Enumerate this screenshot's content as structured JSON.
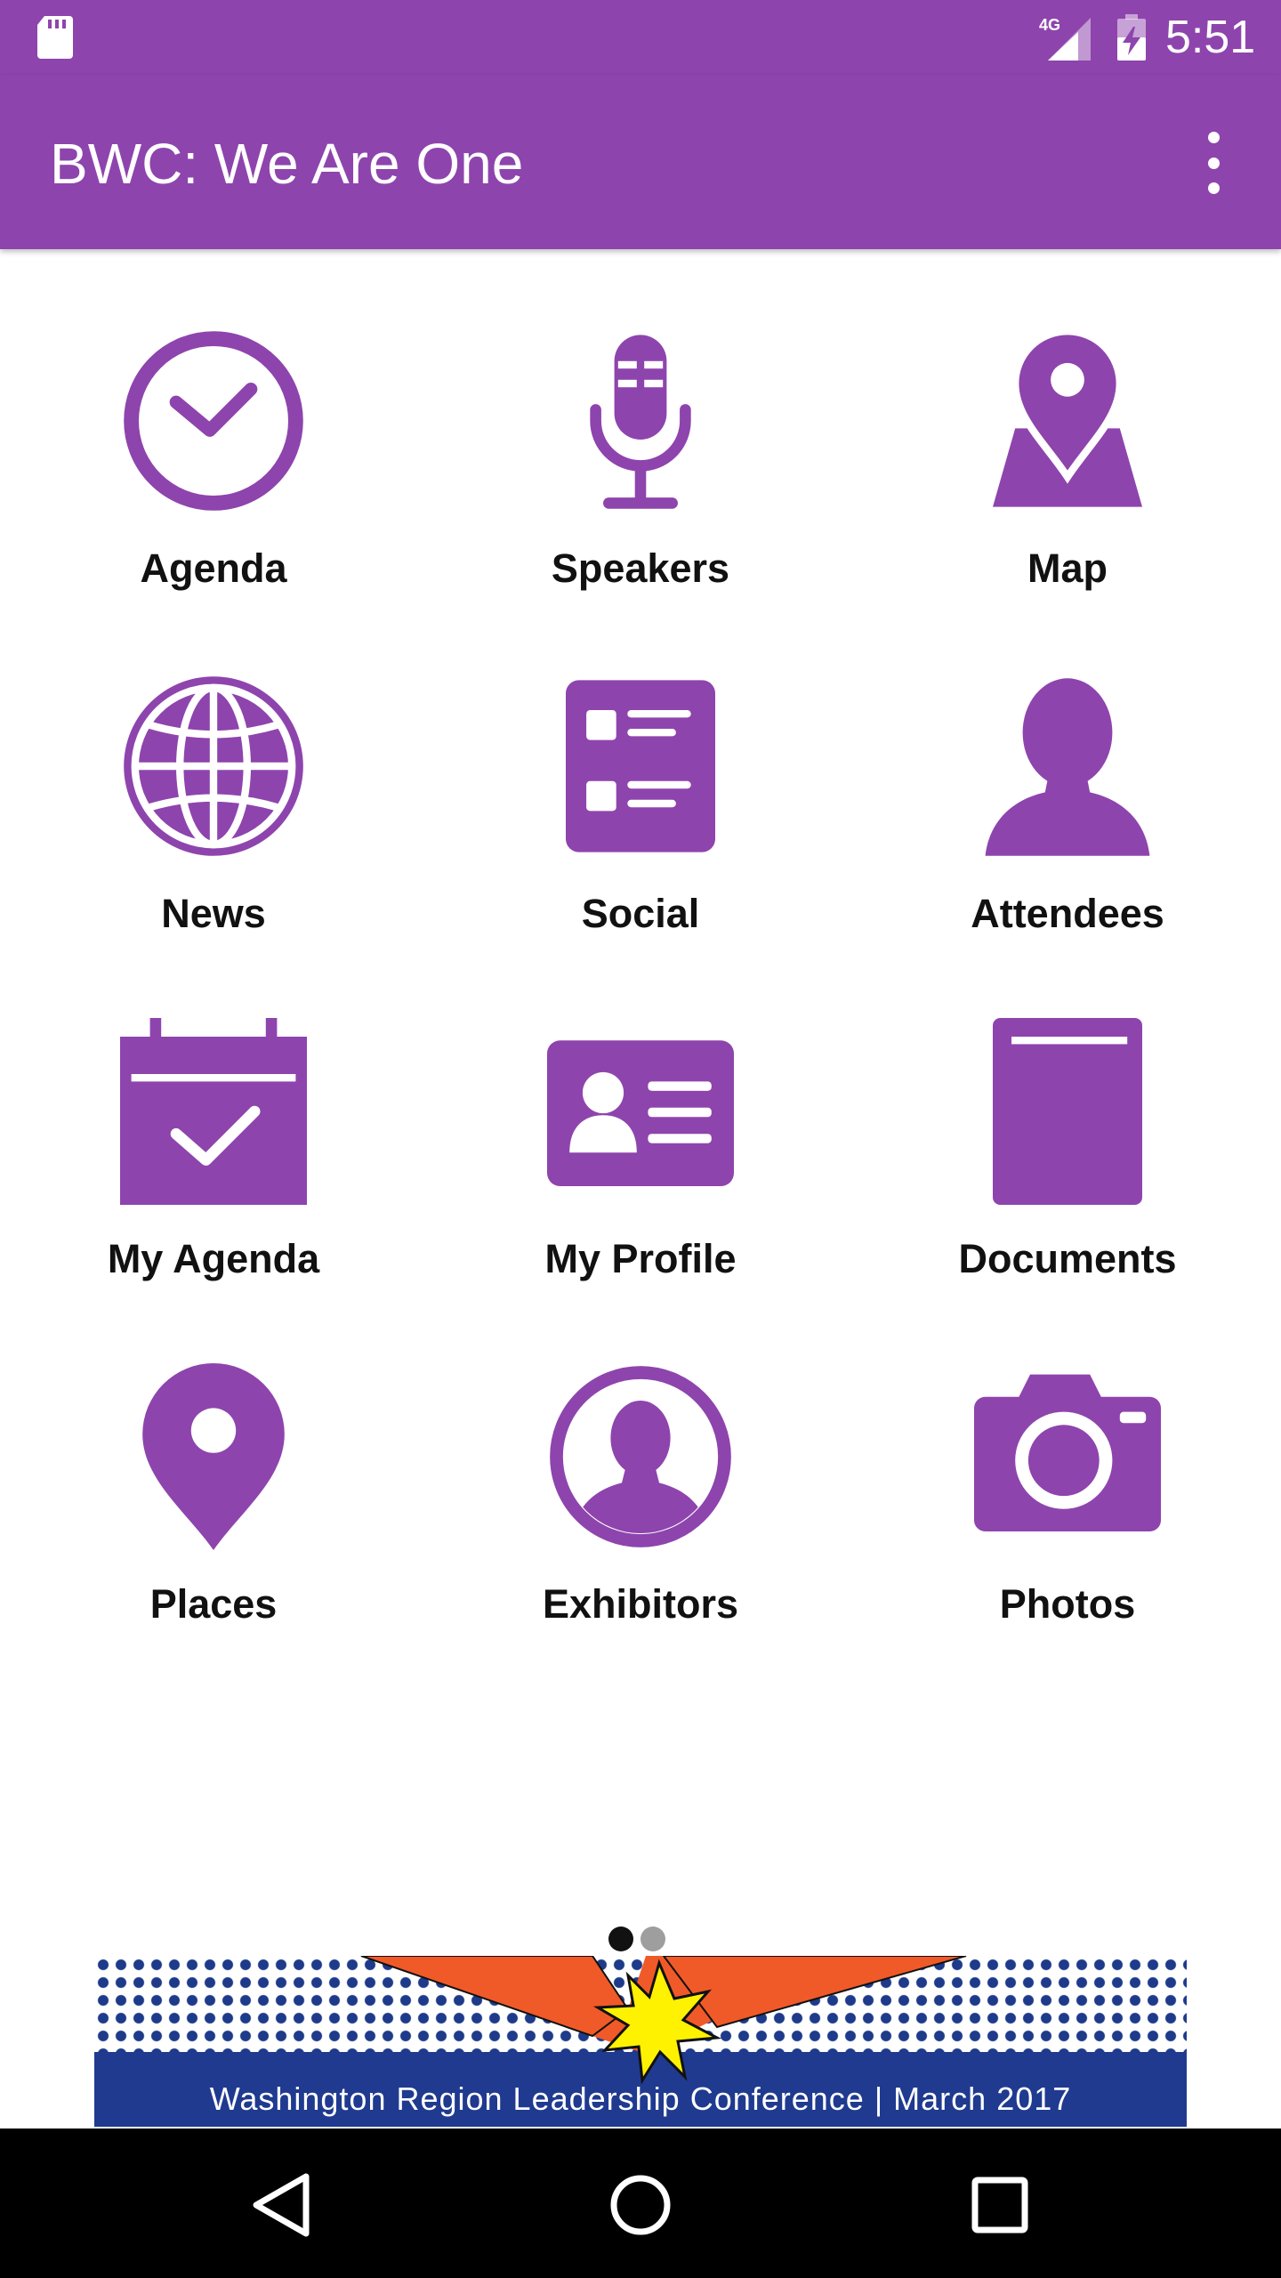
{
  "status_bar": {
    "time": "5:51",
    "network": "4G",
    "icons": [
      "sd-card-icon",
      "signal-icon",
      "battery-charging-icon"
    ]
  },
  "app_bar": {
    "title": "BWC: We Are One",
    "menu_icon": "more-vert-icon"
  },
  "grid": {
    "items": [
      {
        "label": "Agenda",
        "icon": "clock-icon"
      },
      {
        "label": "Speakers",
        "icon": "microphone-icon"
      },
      {
        "label": "Map",
        "icon": "map-pin-icon"
      },
      {
        "label": "News",
        "icon": "globe-icon"
      },
      {
        "label": "Social",
        "icon": "social-list-icon"
      },
      {
        "label": "Attendees",
        "icon": "person-icon"
      },
      {
        "label": "My Agenda",
        "icon": "calendar-check-icon"
      },
      {
        "label": "My Profile",
        "icon": "id-card-icon"
      },
      {
        "label": "Documents",
        "icon": "book-icon"
      },
      {
        "label": "Places",
        "icon": "location-pin-icon"
      },
      {
        "label": "Exhibitors",
        "icon": "person-circle-icon"
      },
      {
        "label": "Photos",
        "icon": "camera-icon"
      }
    ]
  },
  "pager": {
    "count": 2,
    "active": 1
  },
  "banner": {
    "text": "Washington Region Leadership Conference | March 2017"
  },
  "nav_bar": {
    "buttons": [
      "back-icon",
      "home-icon",
      "recents-icon"
    ]
  },
  "colors": {
    "primary": "#8e44ad",
    "banner_blue": "#1f3a8f",
    "burst_orange": "#f05a28",
    "burst_yellow": "#fff200"
  }
}
